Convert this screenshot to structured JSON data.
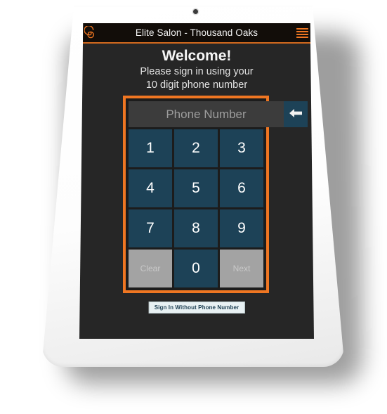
{
  "device": {
    "type": "tablet",
    "bezel_color": "#ffffff",
    "camera": "camera-dot"
  },
  "app": {
    "header": {
      "title": "Elite Salon - Thousand Oaks",
      "logo_icon": "spiral-logo-icon",
      "menu_icon": "hamburger-menu-icon",
      "background_color": "#120d09",
      "accent_color": "#d2691e"
    },
    "screen": {
      "background_color": "#262626",
      "welcome_title": "Welcome!",
      "welcome_line1": "Please sign in using your",
      "welcome_line2": "10 digit phone number"
    },
    "keypad": {
      "border_color": "#ef7622",
      "key_color": "#1d4257",
      "disabled_key_color": "#a3a3a3",
      "phone_input": {
        "value": "",
        "placeholder": "Phone Number"
      },
      "backspace_icon": "backspace-arrow-icon",
      "keys": [
        {
          "label": "1",
          "name": "key-1",
          "style": "number"
        },
        {
          "label": "2",
          "name": "key-2",
          "style": "number"
        },
        {
          "label": "3",
          "name": "key-3",
          "style": "number"
        },
        {
          "label": "4",
          "name": "key-4",
          "style": "number"
        },
        {
          "label": "5",
          "name": "key-5",
          "style": "number"
        },
        {
          "label": "6",
          "name": "key-6",
          "style": "number"
        },
        {
          "label": "7",
          "name": "key-7",
          "style": "number"
        },
        {
          "label": "8",
          "name": "key-8",
          "style": "number"
        },
        {
          "label": "9",
          "name": "key-9",
          "style": "number"
        },
        {
          "label": "Clear",
          "name": "key-clear",
          "style": "muted"
        },
        {
          "label": "0",
          "name": "key-0",
          "style": "number"
        },
        {
          "label": "Next",
          "name": "key-next",
          "style": "muted"
        }
      ]
    },
    "footer": {
      "signin_without_phone_label": "Sign In Without Phone Number"
    }
  }
}
